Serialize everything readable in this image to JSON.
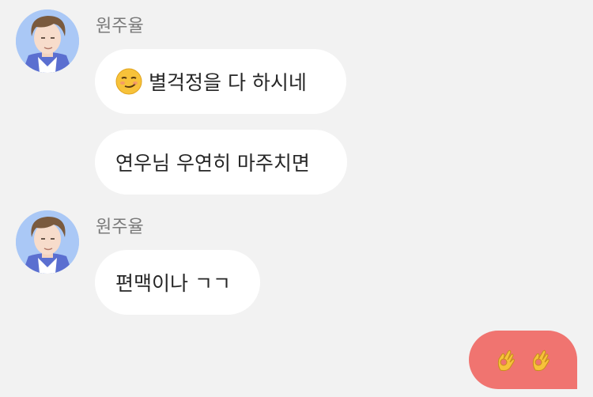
{
  "messages": [
    {
      "sender": "원주율",
      "avatar_icon": "avatar-man-brown-hair",
      "bubbles": [
        {
          "emoji": "smirking-face",
          "text": "별걱정을 다 하시네"
        },
        {
          "text": "연우님 우연히 마주치면"
        }
      ]
    },
    {
      "sender": "원주율",
      "avatar_icon": "avatar-man-brown-hair",
      "bubbles": [
        {
          "text": "편맥이나 ㄱㄱ"
        }
      ]
    }
  ],
  "my_message": {
    "emojis": [
      "ok-hand",
      "ok-hand"
    ],
    "bubble_color": "#f07470"
  },
  "colors": {
    "background": "#f2f2f2",
    "bubble_incoming": "#ffffff",
    "avatar_bg": "#aac8f6"
  }
}
